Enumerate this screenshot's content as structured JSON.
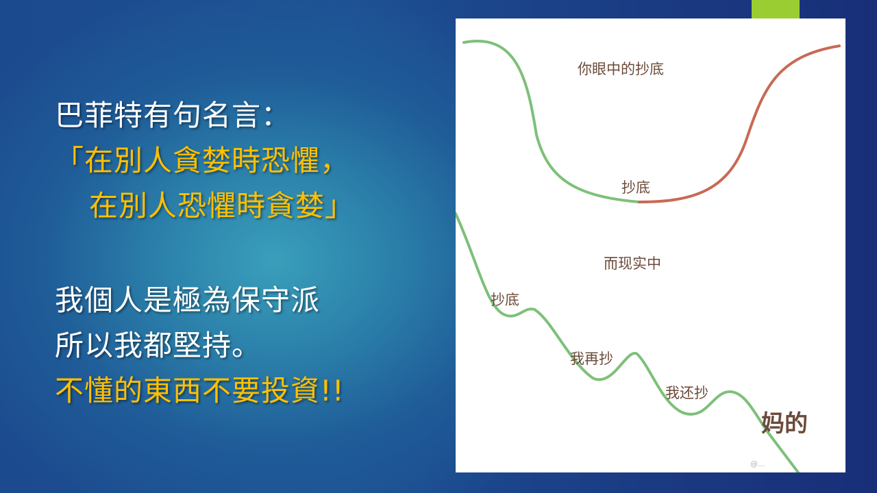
{
  "slide": {
    "accent_color": "#9acd32",
    "text_lines": [
      {
        "text": "巴菲特有句名言：",
        "color": "white"
      },
      {
        "text": "「在別人貪婪時恐懼，",
        "color": "yellow"
      },
      {
        "text": "在別人恐懼時貪婪」",
        "color": "yellow"
      },
      {
        "text": "我個人是極為保守派",
        "color": "white"
      },
      {
        "text": "所以我都堅持。",
        "color": "white"
      },
      {
        "text": "不懂的東西不要投資!!",
        "color": "yellow"
      }
    ]
  },
  "figure": {
    "top_caption": "你眼中的抄底",
    "top_bottom_label": "抄底",
    "middle_caption": "而现实中",
    "label_1": "抄底",
    "label_2": "我再抄",
    "label_3": "我还抄",
    "label_4": "妈的",
    "watermark": "@...",
    "curve_green": "#7ec07a",
    "curve_red": "#c86a55"
  }
}
